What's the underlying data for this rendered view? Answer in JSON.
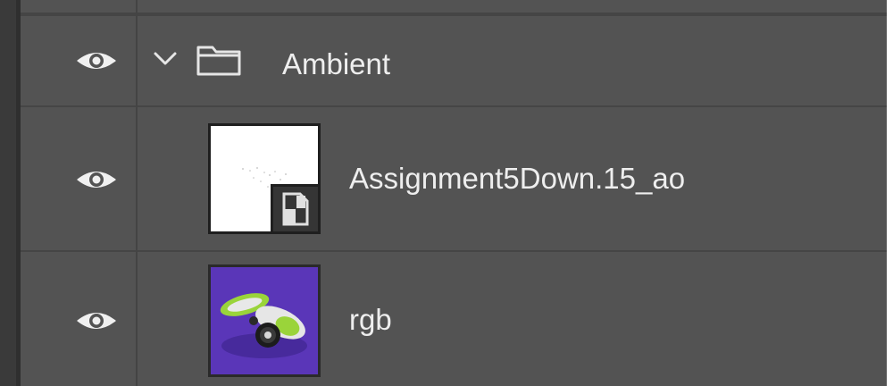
{
  "panel": "Layers",
  "colors": {
    "panel_bg": "#535353",
    "text": "#eeeeee",
    "rgb_thumb_bg": "#5a36b8",
    "bot_green": "#9ad43a"
  },
  "layers": [
    {
      "type": "group",
      "name": "Ambient",
      "visible": true,
      "expanded": true,
      "icon": "folder-icon"
    },
    {
      "type": "smart-object",
      "name": "Assignment5Down.15_ao",
      "visible": true,
      "icon": "smart-object-badge-icon"
    },
    {
      "type": "pixel",
      "name": "rgb",
      "visible": true,
      "thumbnail": "robot-render-thumbnail"
    }
  ]
}
